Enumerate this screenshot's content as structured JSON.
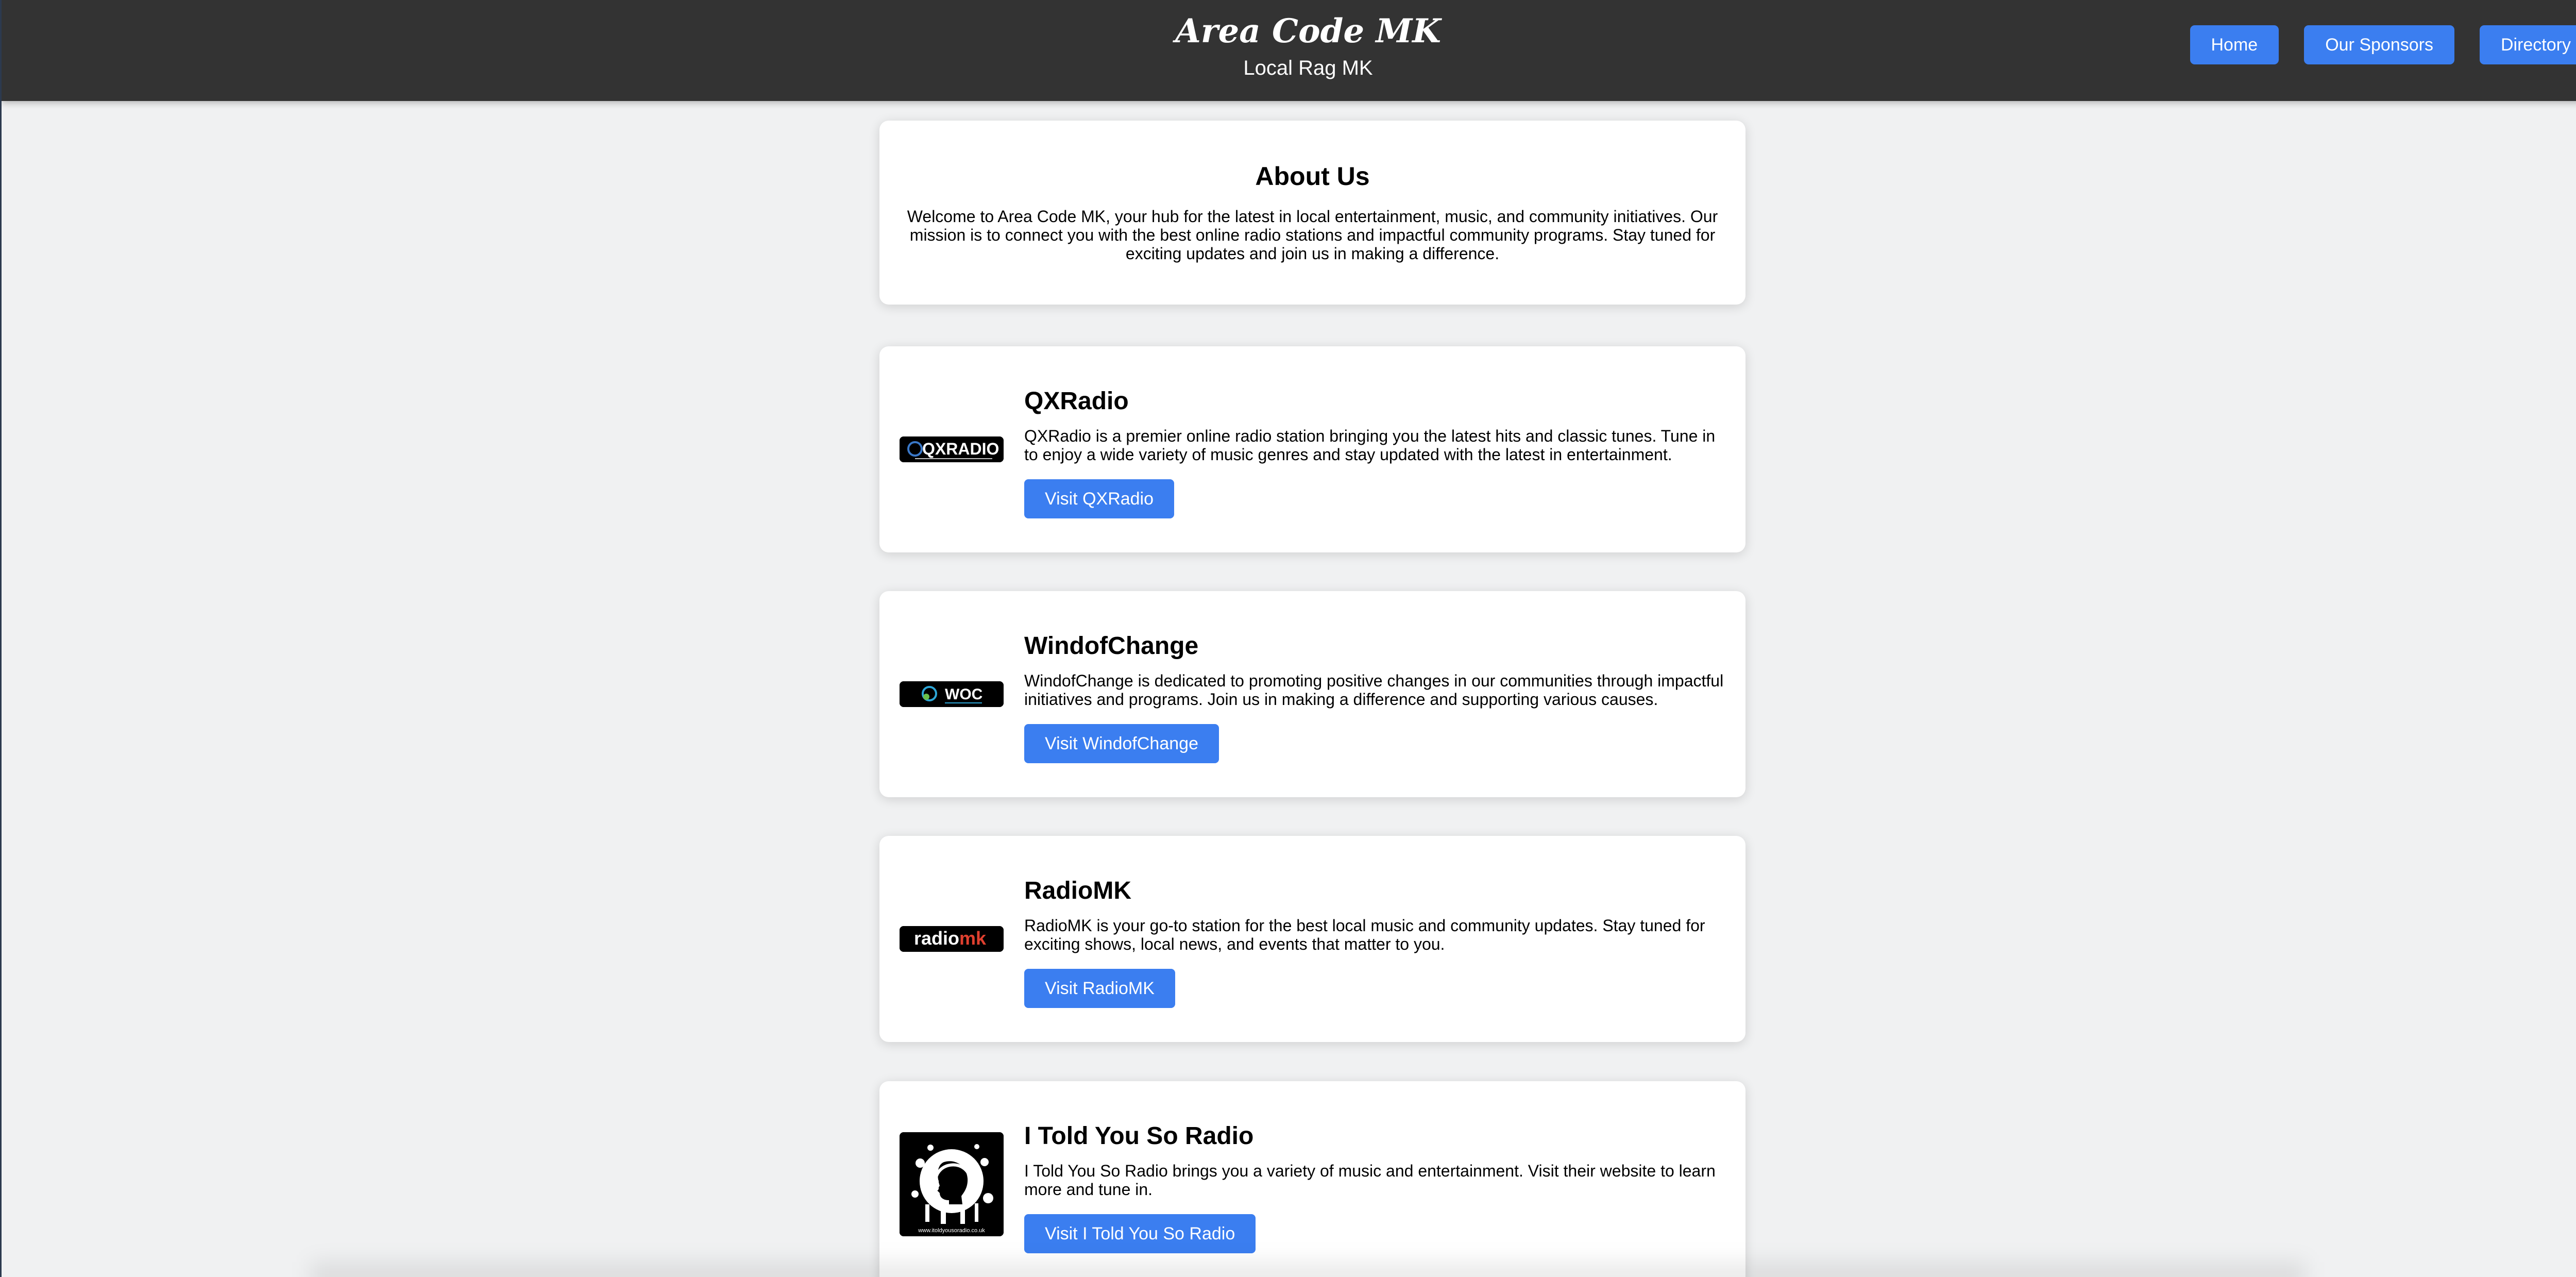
{
  "header": {
    "title": "Area Code MK",
    "subtitle": "Local Rag MK",
    "nav": [
      {
        "label": "Home"
      },
      {
        "label": "Our Sponsors"
      },
      {
        "label": "Directory"
      }
    ]
  },
  "about": {
    "title": "About Us",
    "text": "Welcome to Area Code MK, your hub for the latest in local entertainment, music, and community initiatives. Our mission is to connect you with the best online radio stations and impactful community programs. Stay tuned for exciting updates and join us in making a difference."
  },
  "stations": [
    {
      "name": "QXRadio",
      "logo_text": "QXRADIO",
      "description": "QXRadio is a premier online radio station bringing you the latest hits and classic tunes. Tune in to enjoy a wide variety of music genres and stay updated with the latest in entertainment.",
      "button_label": "Visit QXRadio"
    },
    {
      "name": "WindofChange",
      "logo_text": "WOC",
      "description": "WindofChange is dedicated to promoting positive changes in our communities through impactful initiatives and programs. Join us in making a difference and supporting various causes.",
      "button_label": "Visit WindofChange"
    },
    {
      "name": "RadioMK",
      "logo_text_main": "radio",
      "logo_text_accent": "mk",
      "description": "RadioMK is your go-to station for the best local music and community updates. Stay tuned for exciting shows, local news, and events that matter to you.",
      "button_label": "Visit RadioMK"
    },
    {
      "name": "I Told You So Radio",
      "logo_text": "www.itoldyousoradio.co.uk",
      "description": "I Told You So Radio brings you a variety of music and entertainment. Visit their website to learn more and tune in.",
      "button_label": "Visit I Told You So Radio"
    }
  ],
  "colors": {
    "header_bg": "#333333",
    "button_bg": "#3b7ef0",
    "page_bg": "#f0f1f2",
    "radiomk_accent": "#e0402f"
  }
}
